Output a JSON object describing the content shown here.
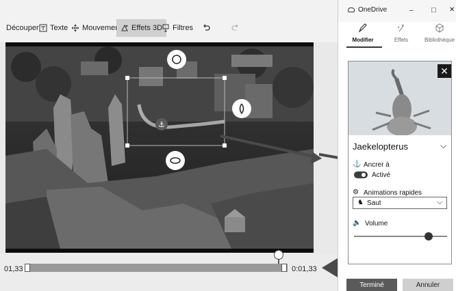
{
  "toolbar": {
    "items": [
      {
        "label": "Découper"
      },
      {
        "label": "Texte"
      },
      {
        "label": "Mouvement"
      },
      {
        "label": "Effets 3D"
      },
      {
        "label": "Filtres"
      }
    ],
    "undo_icon": "undo-icon",
    "redo_icon": "redo-icon"
  },
  "timeline": {
    "start_time": "01,33",
    "end_time": "0:01,33"
  },
  "window": {
    "title": "OneDrive",
    "minimize_glyph": "–",
    "maximize_glyph": "□",
    "close_glyph": "✕"
  },
  "panel": {
    "tabs": [
      {
        "label": "Modifier",
        "icon": "pencil-icon"
      },
      {
        "label": "Effets",
        "icon": "sparkle-icon"
      },
      {
        "label": "Bibliothèque",
        "icon": "cube-icon"
      }
    ],
    "effect_name": "Jaekelopterus",
    "anchor_label": "Ancrer à",
    "toggle_label": "Activé",
    "animations_label": "Animations rapides",
    "animation_selected": "Saut",
    "volume_label": "Volume",
    "volume_level": 0.8,
    "done_button": "Terminé",
    "cancel_button": "Annuler"
  },
  "colors": {
    "accent": "#555555",
    "arrow": "#4a4a4a"
  }
}
